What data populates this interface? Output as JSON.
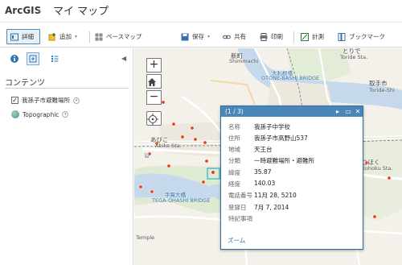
{
  "header": {
    "brand": "ArcGIS",
    "brand_caret": "▾",
    "map_title": "マイ マップ"
  },
  "toolbar": {
    "details": "詳細",
    "add": "追加",
    "basemap": "ベースマップ",
    "save": "保存",
    "share": "共有",
    "print": "印刷",
    "measure": "計測",
    "bookmarks": "ブックマーク",
    "search_value": "住"
  },
  "side_panel": {
    "heading": "コンテンツ",
    "collapse_glyph": "◀",
    "layers": [
      {
        "label": "我孫子市避難場所",
        "checked": true
      },
      {
        "label": "Topographic"
      }
    ]
  },
  "map": {
    "zoom_in": "+",
    "zoom_out": "−",
    "labels": {
      "shinmachi": "新町",
      "shinmachi_en": "Shimmachi",
      "toride_sta": "とりで",
      "toride_sta_en": "Toride Sta.",
      "ohashi": "大利根橋",
      "ohashi_en": "OTONE-BASHI BRIDGE",
      "torideshi": "取手市",
      "torideshi_en": "Toride-Shi",
      "abiko": "あびこ",
      "abiko_en": "Abiko Sta.",
      "kohoku": "こほく",
      "kohoku_en": "Kohoku Sta.",
      "teganuma": "手賀大橋",
      "teganuma_en": "TEGA-OHASHI BRIDGE",
      "temple": "Temple",
      "route6": "6",
      "route356": "356"
    },
    "accent": "#4a87b8",
    "marker_color": "#e8411f"
  },
  "popup": {
    "counter": "(1 / 3)",
    "next": "▸",
    "maximize": "▭",
    "close": "✕",
    "fields": [
      {
        "label": "名称",
        "value": "我孫子中学校"
      },
      {
        "label": "住所",
        "value": "我孫子市高野山537"
      },
      {
        "label": "地域",
        "value": "天王台"
      },
      {
        "label": "分類",
        "value": "一時避難場所・避難所"
      },
      {
        "label": "緯度",
        "value": "35.87"
      },
      {
        "label": "経度",
        "value": "140.03"
      },
      {
        "label": "電話番号",
        "value": "11月 28, 5210"
      },
      {
        "label": "登録日",
        "value": "7月 7, 2014"
      },
      {
        "label": "特記事項",
        "value": ""
      }
    ],
    "zoom_link": "ズーム"
  }
}
